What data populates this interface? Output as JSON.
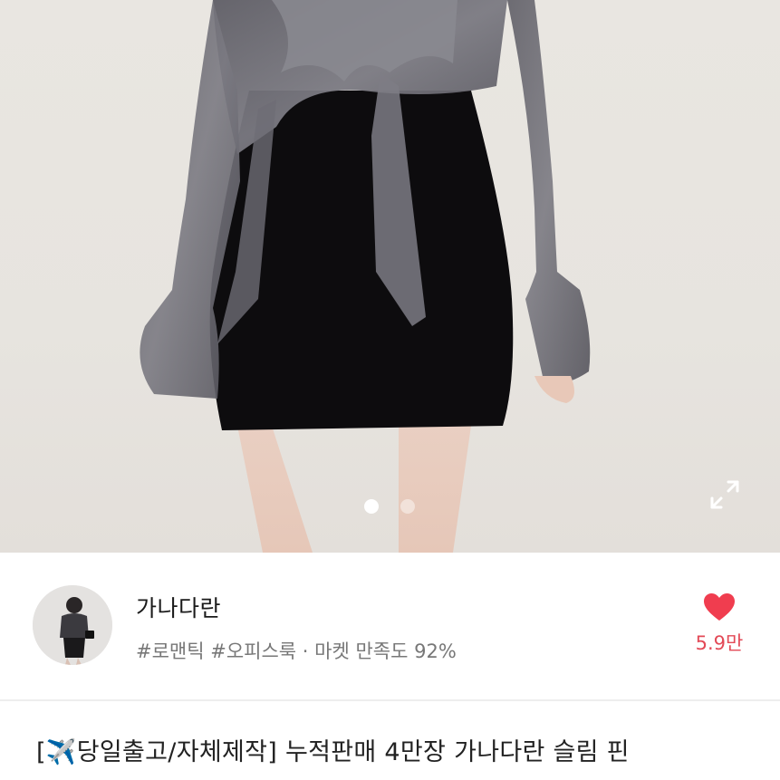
{
  "product_image": {
    "slide_count": 2,
    "active_slide": 1
  },
  "seller": {
    "name": "가나다란",
    "tags": "#로맨틱 #오피스룩",
    "separator": " · ",
    "satisfaction_label": "마켓 만족도",
    "satisfaction_value": "92%"
  },
  "like": {
    "count": "5.9만",
    "icon": "heart-icon",
    "color": "#f03d4f"
  },
  "product": {
    "title": "[✈️당일출고/자체제작] 누적판매 4만장 가나다란 슬림 핀"
  },
  "colors": {
    "like_text": "#e34a57",
    "meta_text": "#777777",
    "title_text": "#222222"
  }
}
